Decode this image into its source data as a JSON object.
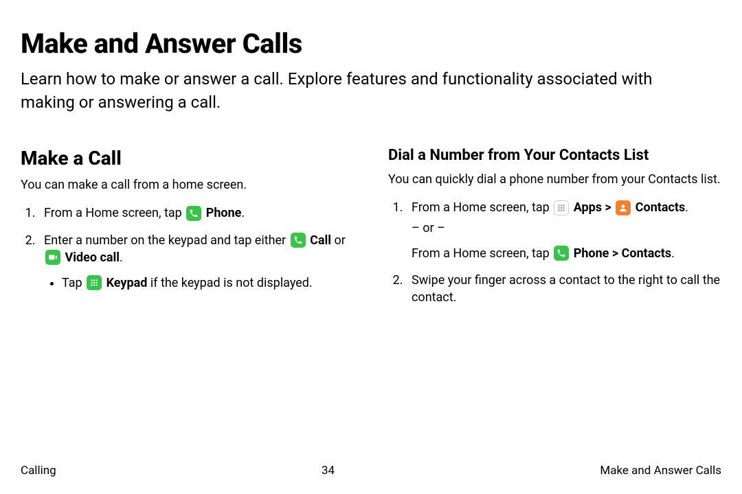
{
  "title": "Make and Answer Calls",
  "intro": "Learn how to make or answer a call. Explore features and functionality associated with making or answering a call.",
  "left": {
    "heading": "Make a Call",
    "lead": "You can make a call from a home screen.",
    "step1_pre": "From a Home screen, tap ",
    "step1_phone": "Phone",
    "step1_post": ".",
    "step2_pre": "Enter a number on the keypad and tap either ",
    "step2_call": "Call",
    "step2_or": " or ",
    "step2_video": "Video call",
    "step2_post": ".",
    "bullet_pre": "Tap ",
    "bullet_keypad": "Keypad",
    "bullet_post": " if the keypad is not displayed."
  },
  "right": {
    "heading": "Dial a Number from Your Contacts List",
    "lead": "You can quickly dial a phone number from your Contacts list.",
    "step1_pre": "From a Home screen, tap ",
    "step1_apps": "Apps",
    "step1_sep": " > ",
    "step1_contacts": "Contacts",
    "step1_post": ".",
    "or": "– or –",
    "alt_pre": "From a Home screen, tap ",
    "alt_phone": "Phone",
    "alt_sep": " > ",
    "alt_contacts": "Contacts",
    "alt_post": ".",
    "step2": "Swipe your finger across a contact to the right to call the contact."
  },
  "footer": {
    "left": "Calling",
    "center": "34",
    "right": "Make and Answer Calls"
  }
}
